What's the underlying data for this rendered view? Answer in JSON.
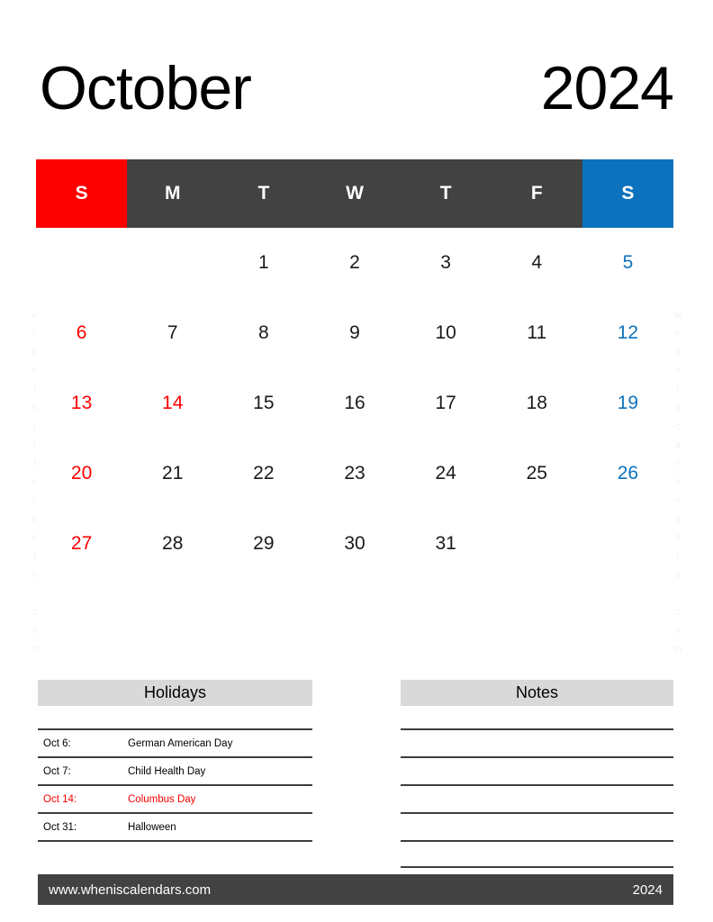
{
  "title": {
    "month": "October",
    "year": "2024"
  },
  "colors": {
    "sunday_red": "#fc0000",
    "saturday_blue": "#0d72bd",
    "header_gray": "#424242",
    "panel_head_gray": "#d9d9d9"
  },
  "calendar": {
    "day_headers": [
      {
        "label": "S",
        "kind": "sun"
      },
      {
        "label": "M",
        "kind": "weekday"
      },
      {
        "label": "T",
        "kind": "weekday"
      },
      {
        "label": "W",
        "kind": "weekday"
      },
      {
        "label": "T",
        "kind": "weekday"
      },
      {
        "label": "F",
        "kind": "weekday"
      },
      {
        "label": "S",
        "kind": "sat"
      }
    ],
    "weeks": [
      [
        {
          "n": "",
          "c": "empty"
        },
        {
          "n": "",
          "c": "empty"
        },
        {
          "n": "1",
          "c": "black"
        },
        {
          "n": "2",
          "c": "black"
        },
        {
          "n": "3",
          "c": "black"
        },
        {
          "n": "4",
          "c": "black"
        },
        {
          "n": "5",
          "c": "blue"
        }
      ],
      [
        {
          "n": "6",
          "c": "red"
        },
        {
          "n": "7",
          "c": "black"
        },
        {
          "n": "8",
          "c": "black"
        },
        {
          "n": "9",
          "c": "black"
        },
        {
          "n": "10",
          "c": "black"
        },
        {
          "n": "11",
          "c": "black"
        },
        {
          "n": "12",
          "c": "blue"
        }
      ],
      [
        {
          "n": "13",
          "c": "red"
        },
        {
          "n": "14",
          "c": "red"
        },
        {
          "n": "15",
          "c": "black"
        },
        {
          "n": "16",
          "c": "black"
        },
        {
          "n": "17",
          "c": "black"
        },
        {
          "n": "18",
          "c": "black"
        },
        {
          "n": "19",
          "c": "blue"
        }
      ],
      [
        {
          "n": "20",
          "c": "red"
        },
        {
          "n": "21",
          "c": "black"
        },
        {
          "n": "22",
          "c": "black"
        },
        {
          "n": "23",
          "c": "black"
        },
        {
          "n": "24",
          "c": "black"
        },
        {
          "n": "25",
          "c": "black"
        },
        {
          "n": "26",
          "c": "blue"
        }
      ],
      [
        {
          "n": "27",
          "c": "red"
        },
        {
          "n": "28",
          "c": "black"
        },
        {
          "n": "29",
          "c": "black"
        },
        {
          "n": "30",
          "c": "black"
        },
        {
          "n": "31",
          "c": "black"
        },
        {
          "n": "",
          "c": "empty"
        },
        {
          "n": "",
          "c": "empty"
        }
      ]
    ]
  },
  "holidays": {
    "heading": "Holidays",
    "rows": [
      {
        "date": "Oct 6:",
        "name": "German American Day",
        "highlight": false
      },
      {
        "date": "Oct 7:",
        "name": "Child Health Day",
        "highlight": false
      },
      {
        "date": "Oct 14:",
        "name": "Columbus Day",
        "highlight": true
      },
      {
        "date": "Oct 31:",
        "name": "Halloween",
        "highlight": false
      }
    ]
  },
  "notes": {
    "heading": "Notes",
    "line_count": 5
  },
  "footer": {
    "url": "www.wheniscalendars.com",
    "year": "2024"
  },
  "watermark": {
    "text": "wheniscalendars.com"
  }
}
